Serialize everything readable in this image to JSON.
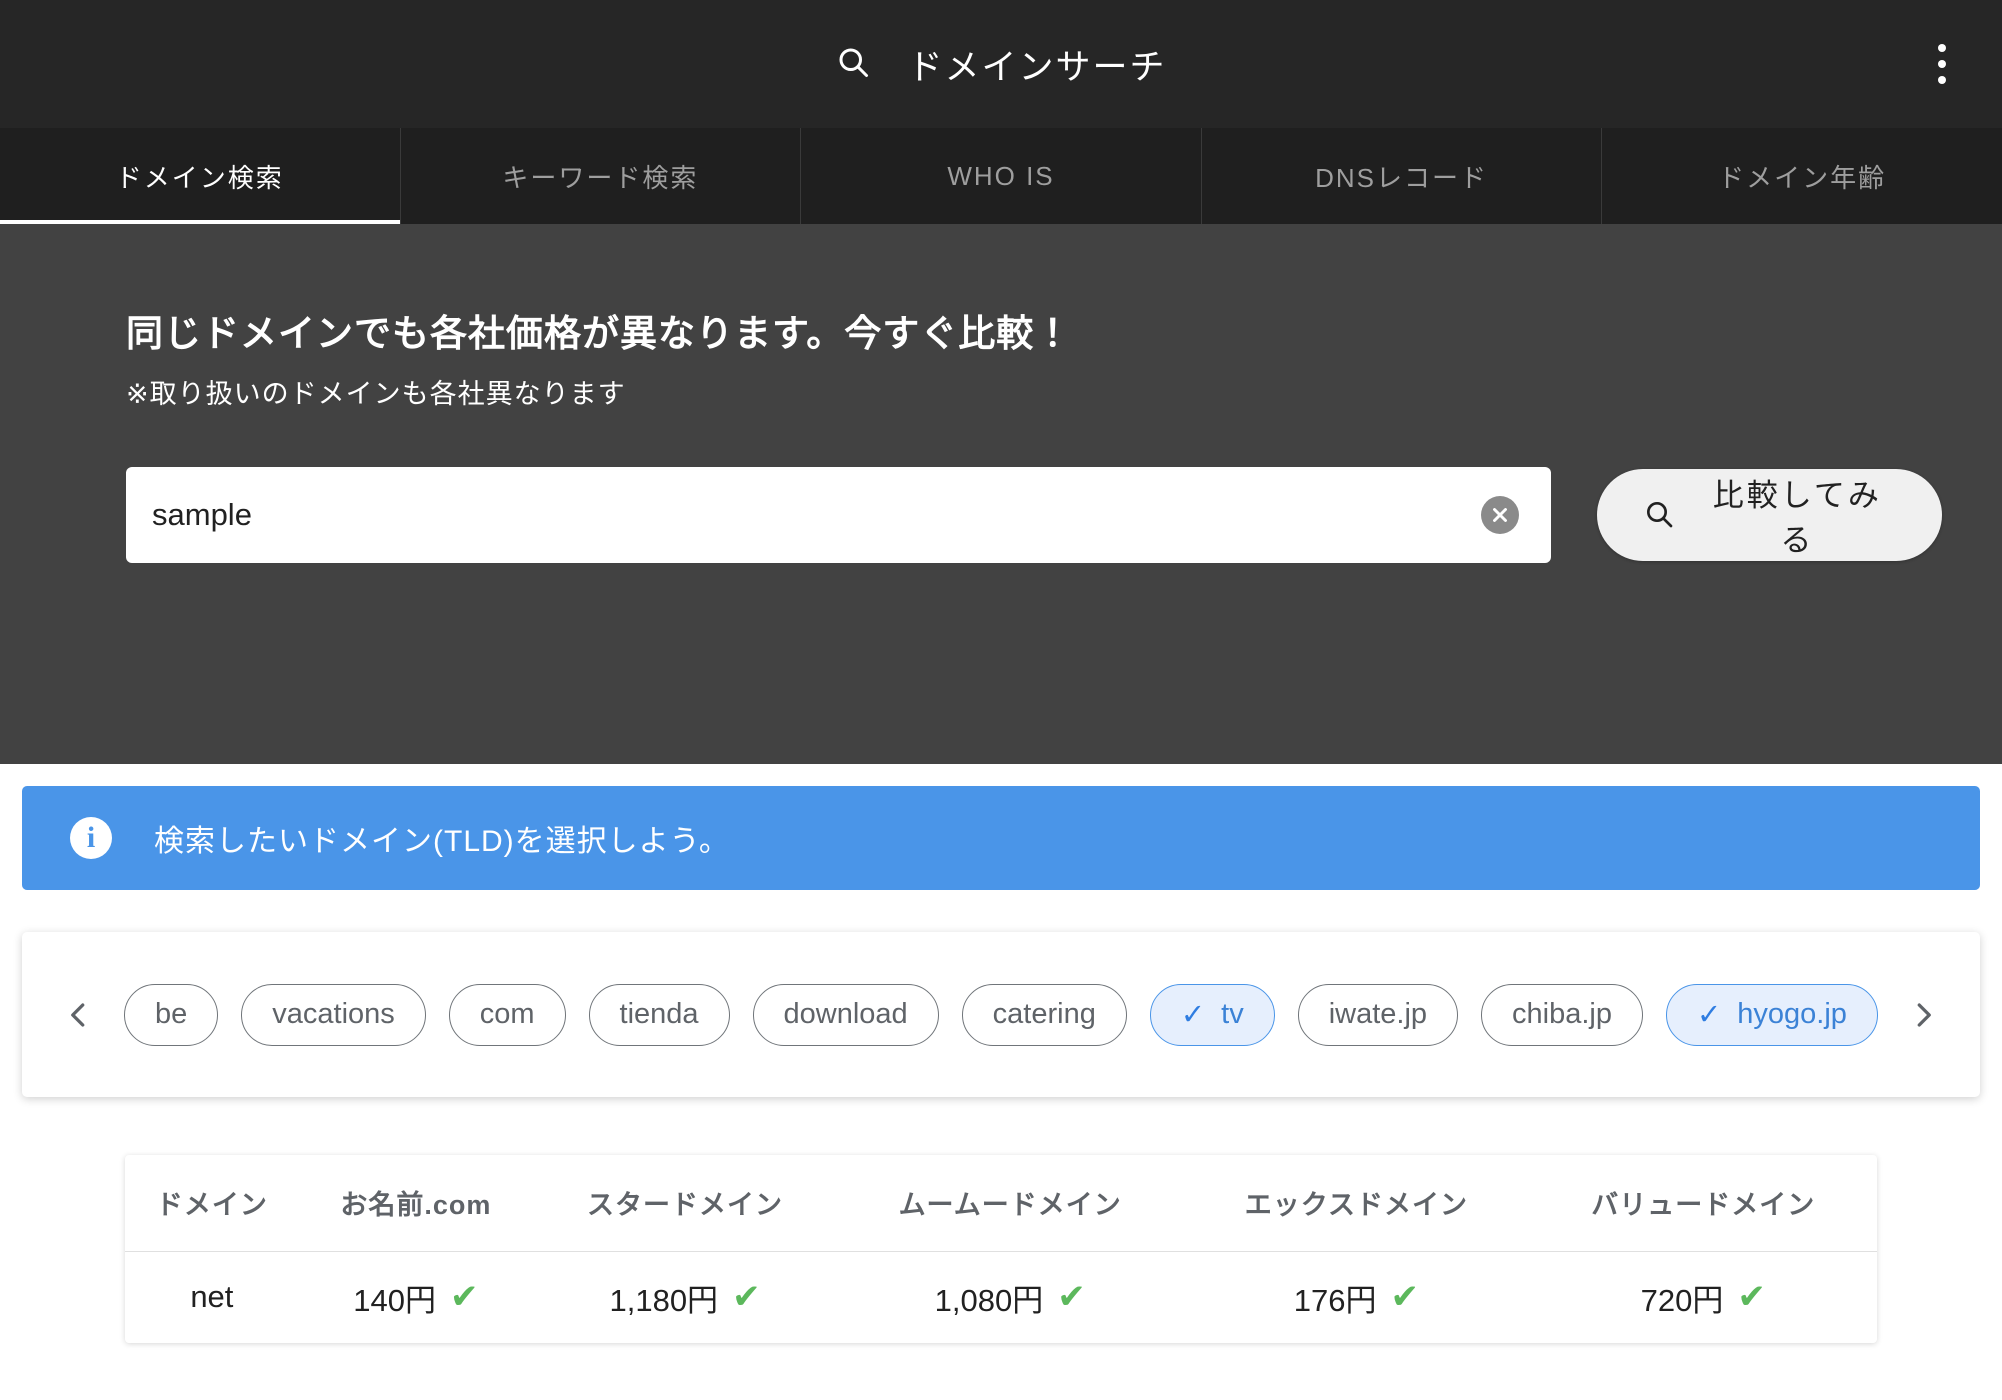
{
  "appbar": {
    "title": "ドメインサーチ",
    "search_icon": "search-icon",
    "menu_icon": "more-vertical-icon"
  },
  "tabs": [
    {
      "label": "ドメイン検索",
      "active": true
    },
    {
      "label": "キーワード検索",
      "active": false
    },
    {
      "label": "WHO IS",
      "active": false
    },
    {
      "label": "DNSレコード",
      "active": false
    },
    {
      "label": "ドメイン年齢",
      "active": false
    }
  ],
  "hero": {
    "headline": "同じドメインでも各社価格が異なります。今すぐ比較！",
    "subtitle": "※取り扱いのドメインも各社異なります",
    "search": {
      "value": "sample",
      "placeholder": "",
      "clear_icon": "clear-circle-icon"
    },
    "compare_button": {
      "label": "比較してみる",
      "icon": "search-icon"
    },
    "background_color": "#424242"
  },
  "banner": {
    "icon": "info-icon",
    "text": "検索したいドメイン(TLD)を選択しよう。",
    "color": "#4a95e8"
  },
  "tld_selector": {
    "prev_icon": "chevron-left-icon",
    "next_icon": "chevron-right-icon",
    "check_icon": "check-icon",
    "selected_color": "#3b82d6",
    "chips": [
      {
        "label": "be",
        "selected": false
      },
      {
        "label": "vacations",
        "selected": false
      },
      {
        "label": "com",
        "selected": false
      },
      {
        "label": "tienda",
        "selected": false
      },
      {
        "label": "download",
        "selected": false
      },
      {
        "label": "catering",
        "selected": false
      },
      {
        "label": "tv",
        "selected": true
      },
      {
        "label": "iwate.jp",
        "selected": false
      },
      {
        "label": "chiba.jp",
        "selected": false
      },
      {
        "label": "hyogo.jp",
        "selected": true
      }
    ]
  },
  "table": {
    "headers": [
      "ドメイン",
      "お名前.com",
      "スタードメイン",
      "ムームードメイン",
      "エックスドメイン",
      "バリュードメイン"
    ],
    "check_icon": "check-mark-icon",
    "check_color": "#5cb85c",
    "rows": [
      {
        "domain": "net",
        "prices": [
          {
            "value": "140円",
            "available": true
          },
          {
            "value": "1,180円",
            "available": true
          },
          {
            "value": "1,080円",
            "available": true
          },
          {
            "value": "176円",
            "available": true
          },
          {
            "value": "720円",
            "available": true
          }
        ]
      }
    ]
  }
}
